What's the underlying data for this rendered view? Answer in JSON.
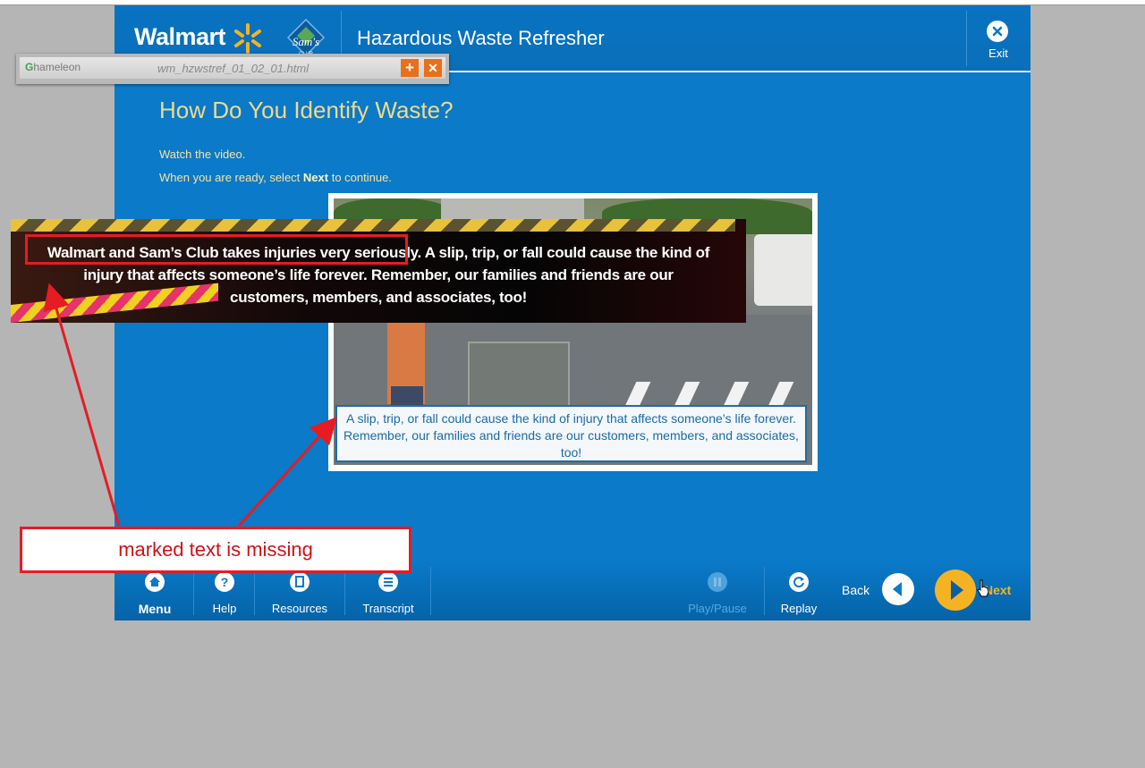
{
  "header": {
    "brand": "Walmart",
    "sams_logo_text": "Sam's",
    "course_title": "Hazardous Waste Refresher",
    "exit_label": "Exit"
  },
  "chameleon": {
    "logo_text": "hameleon",
    "filename": "wm_hzwstref_01_02_01.html",
    "add_icon": "+",
    "close_icon": "✕"
  },
  "page": {
    "title": "How Do You Identify Waste?",
    "instruction1": "Watch the video.",
    "instruction2_pre": "When you are ready, select ",
    "instruction2_bold": "Next",
    "instruction2_post": " to continue."
  },
  "video": {
    "caption": "A slip, trip, or fall could cause the kind of injury that affects someone’s life forever.  Remember, our families and friends are our customers, members, and associates, too!"
  },
  "overlay": {
    "line1_marked": "Walmart and Sam’s Club takes injuries very seriously.",
    "line1_rest": "  A slip, trip, or fall could cause the kind of",
    "line2": "injury that affects someone’s life forever.  Remember, our families and friends are our",
    "line3": "customers, members, and associates, too!"
  },
  "annotation": {
    "text": "marked text is missing",
    "color": "#e51c23"
  },
  "toolbar": {
    "menu": "Menu",
    "help": "Help",
    "resources": "Resources",
    "transcript": "Transcript",
    "play_pause": "Play/Pause",
    "replay": "Replay",
    "back": "Back",
    "next": "Next"
  },
  "colors": {
    "app_blue": "#0a7ac9",
    "title_gold": "#f2d98a",
    "next_orange": "#f5b324"
  }
}
